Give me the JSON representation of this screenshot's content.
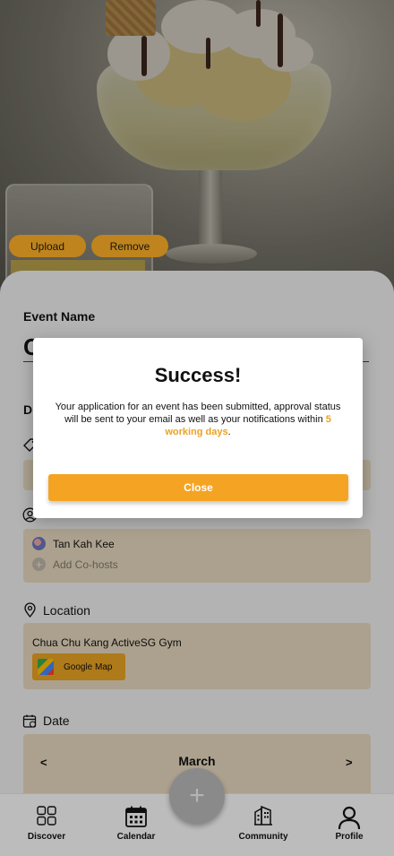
{
  "photo": {
    "upload_label": "Upload",
    "remove_label": "Remove"
  },
  "form": {
    "event_name_label": "Event Name",
    "event_name_value": "C",
    "description_label_partial": "D",
    "hosts": {
      "host_name": "Tan Kah Kee",
      "add_cohosts_label": "Add Co-hosts"
    },
    "location": {
      "label": "Location",
      "value": "Chua Chu Kang ActiveSG Gym",
      "map_button_label": "Google Map"
    },
    "date": {
      "label": "Date",
      "month": "March",
      "prev": "<",
      "next": ">"
    }
  },
  "modal": {
    "title": "Success!",
    "message_before": "Your application for an event has been submitted, approval status will be sent to your email as well as your notifications within ",
    "message_highlight": "5 working days",
    "message_after": ".",
    "close_label": "Close",
    "highlight_color": "#e9a224"
  },
  "nav": {
    "items": [
      {
        "label": "Discover",
        "icon": "grid-icon"
      },
      {
        "label": "Calendar",
        "icon": "calendar-icon"
      },
      {
        "label": "Community",
        "icon": "buildings-icon"
      },
      {
        "label": "Profile",
        "icon": "person-icon"
      }
    ],
    "fab_symbol": "+"
  },
  "colors": {
    "accent": "#f4a422",
    "field_bg": "#e0d2b9",
    "sheet_bg": "#e9e9e9"
  }
}
